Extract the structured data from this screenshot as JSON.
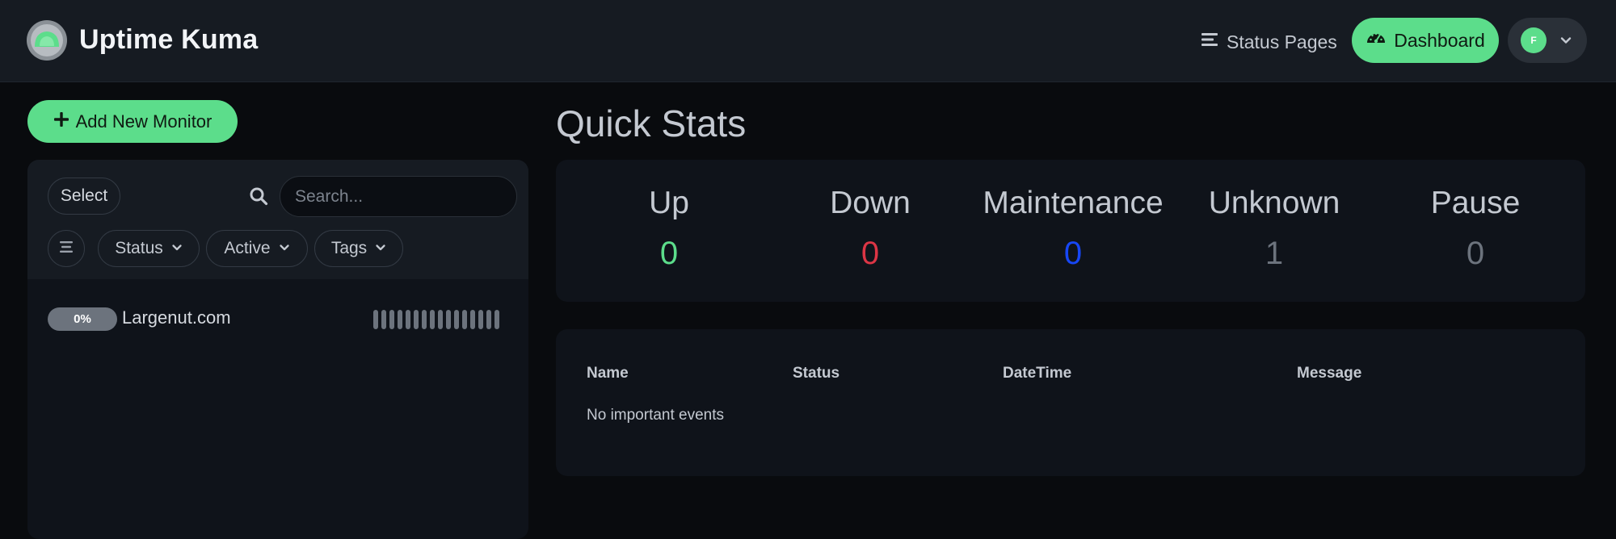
{
  "header": {
    "app_title": "Uptime Kuma",
    "status_pages_label": "Status Pages",
    "dashboard_label": "Dashboard",
    "avatar_initial": "F",
    "accent_color": "#5cdd8b"
  },
  "sidebar": {
    "add_monitor_label": "Add New Monitor",
    "select_label": "Select",
    "search_placeholder": "Search...",
    "filters": {
      "status_label": "Status",
      "active_label": "Active",
      "tags_label": "Tags"
    },
    "monitors": [
      {
        "uptime": "0%",
        "name": "Largenut.com",
        "heartbeats": [
          "unknown",
          "unknown",
          "unknown",
          "unknown",
          "unknown",
          "unknown",
          "unknown",
          "unknown",
          "unknown",
          "unknown",
          "unknown",
          "unknown",
          "unknown",
          "unknown",
          "unknown",
          "unknown"
        ]
      }
    ]
  },
  "main": {
    "quick_stats_title": "Quick Stats",
    "stats": [
      {
        "label": "Up",
        "value": "0",
        "color": "#5cdd8b"
      },
      {
        "label": "Down",
        "value": "0",
        "color": "#dc3545"
      },
      {
        "label": "Maintenance",
        "value": "0",
        "color": "#1747f5"
      },
      {
        "label": "Unknown",
        "value": "1",
        "color": "#6c737d"
      },
      {
        "label": "Pause",
        "value": "0",
        "color": "#6c737d"
      }
    ],
    "events": {
      "columns": [
        "Name",
        "Status",
        "DateTime",
        "Message"
      ],
      "empty_text": "No important events"
    }
  }
}
